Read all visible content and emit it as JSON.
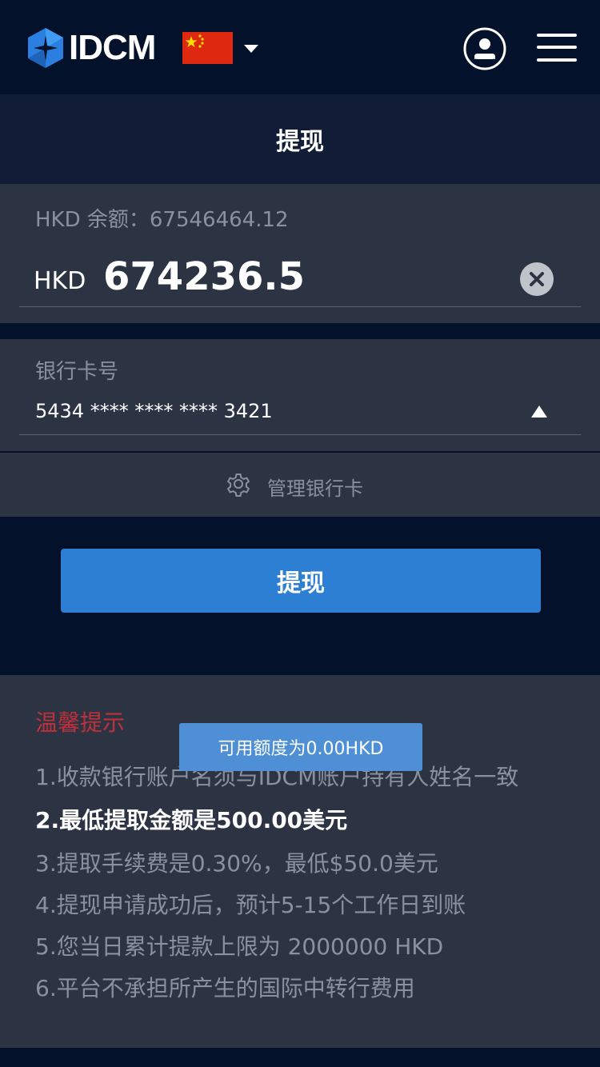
{
  "header": {
    "brand": "IDCM",
    "flag_icon": "china-flag-icon",
    "colors": {
      "background": "#04112a",
      "logo": "#2a7fe0"
    }
  },
  "titlebar": {
    "title": "提现"
  },
  "amount": {
    "balance_label": "HKD 余额：67546464.12",
    "currency": "HKD",
    "value": "674236.5"
  },
  "bank": {
    "label": "银行卡号",
    "card_number": "5434 **** **** **** 3421"
  },
  "manage": {
    "label": "管理银行卡"
  },
  "submit": {
    "label": "提现",
    "color": "#2d7fd3"
  },
  "tips": {
    "title": "温馨提示",
    "items": [
      "1.收款银行账户名须与IDCM账户持有人姓名一致",
      "2.最低提取金额是500.00美元",
      "3.提取手续费是0.30%，最低$50.0美元",
      "4.提现申请成功后，预计5-15个工作日到账",
      "5.您当日累计提款上限为 2000000 HKD",
      "6.平台不承担所产生的国际中转行费用"
    ]
  },
  "toast": {
    "text": "可用额度为0.00HKD"
  }
}
